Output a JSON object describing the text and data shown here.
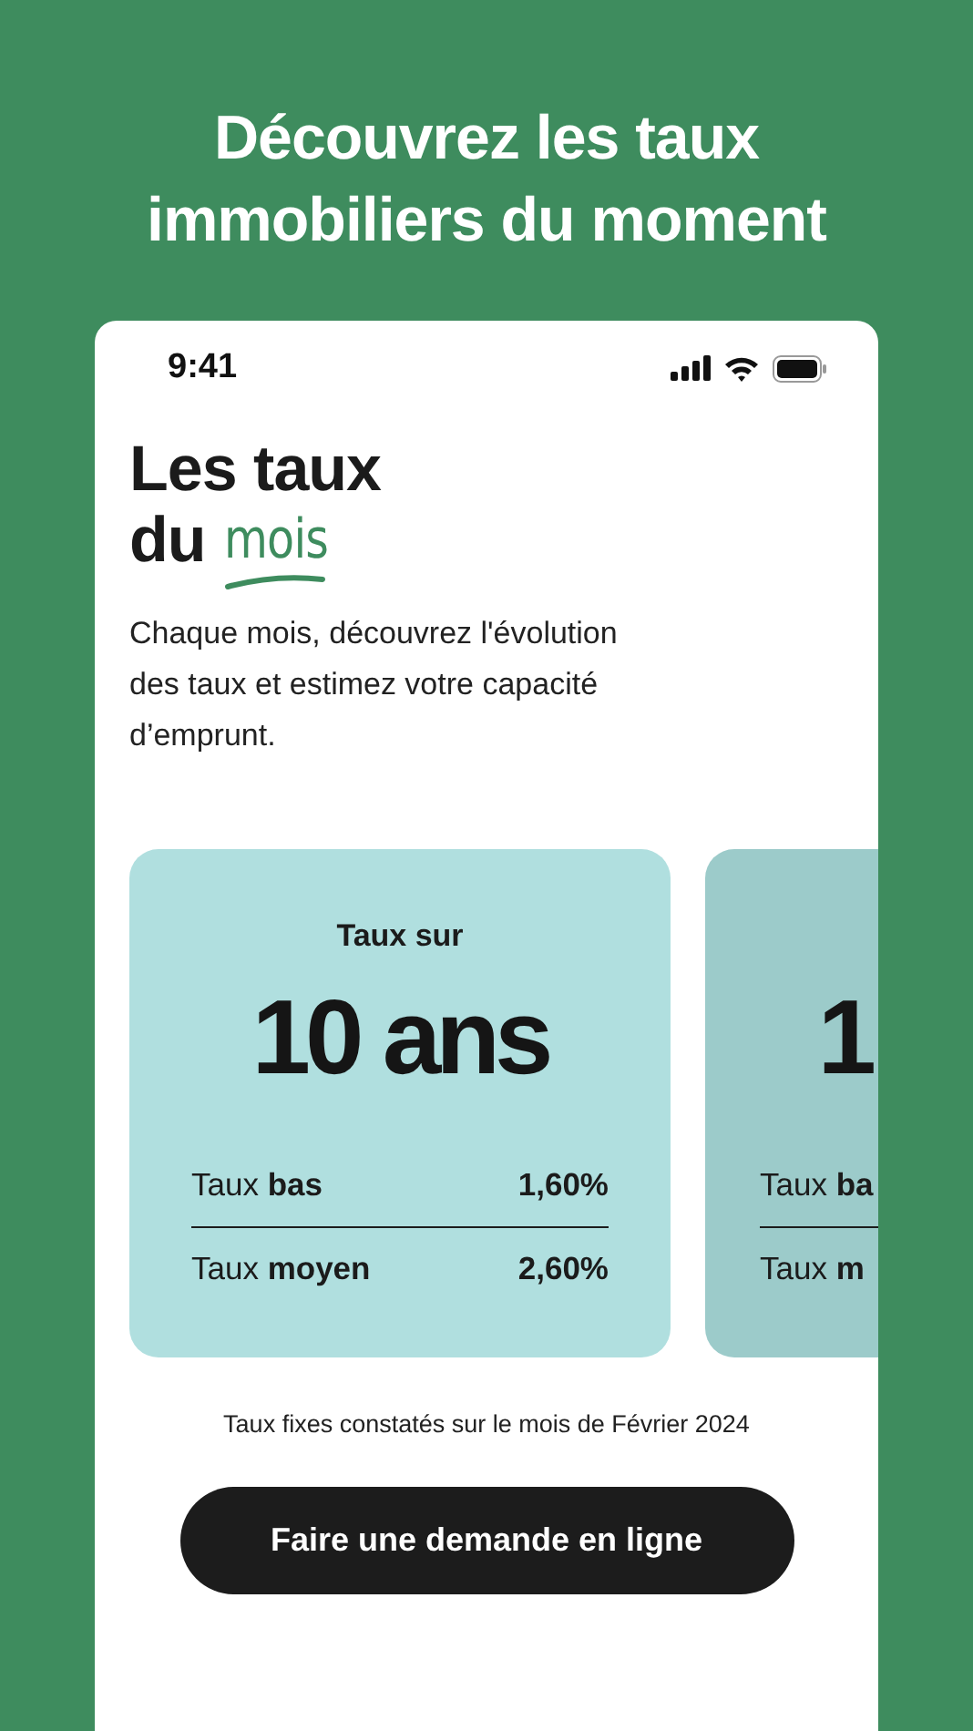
{
  "headline": {
    "lines": [
      "Découvrez les taux",
      "immobiliers du moment"
    ]
  },
  "status_bar": {
    "time": "9:41"
  },
  "title": {
    "line_1": "Les taux",
    "line_2_prefix": "du",
    "highlight": "mois"
  },
  "intro": "Chaque mois, découvrez l'évolution des taux et estimez votre capacité d’emprunt.",
  "cards": [
    {
      "clipped": false,
      "color": "#b0dfdf",
      "title": "Taux sur",
      "term": "10 ans",
      "rows": [
        {
          "label": "Taux **bas**",
          "value": "1,60%"
        },
        {
          "label": "Taux **moyen**",
          "value": "2,60%"
        }
      ]
    },
    {
      "clipped": true,
      "color": "#9ccbca",
      "term": "1",
      "rows": [
        {
          "label": "Taux **ba**"
        },
        {
          "label": "Taux **m**"
        }
      ]
    }
  ],
  "footnote": "Taux fixes constatés sur le mois de Février 2024",
  "cta": "Faire une demande en ligne"
}
